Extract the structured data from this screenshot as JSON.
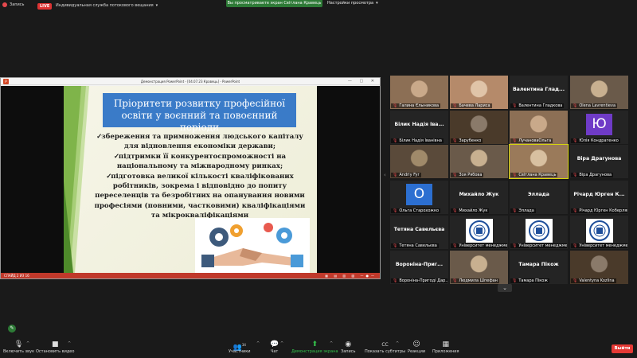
{
  "topbar": {
    "recording_label": "Запись",
    "live_badge": "LIVE",
    "live_service": "Индивидуальная служба потокового вещания",
    "viewing_banner": "Вы просматриваете экран Світлана Кравець",
    "view_options": "Настройки просмотра"
  },
  "ppt": {
    "window_title": "Демонстрация PowerPoint - [04.07.23 Кравець] - PowerPoint",
    "logo_letter": "P",
    "status_text": "СЛАЙД 2 ИЗ 16"
  },
  "slide": {
    "title": "Пріоритети розвитку професійної освіти у воєнний та повоєнний періоди",
    "bullets": [
      "збереження та примноження людського капіталу для відновлення економіки держави;",
      "підтримки її конкурентоспроможності на національному та міжнародному ринках;",
      "підготовка великої кількості кваліфікованих робітників, зокрема і відповідно до попиту переселенців та безробітних на опанування новими професіями (повними, частковими) кваліфікаціями та мікрокваліфікаціями"
    ]
  },
  "gallery": {
    "tiles": [
      {
        "label": "Галина Єлыникова",
        "name": "",
        "type": "video",
        "active": false
      },
      {
        "label": "Бачева Лариса",
        "name": "",
        "type": "video",
        "active": false
      },
      {
        "label": "Валентина Гладкова",
        "name": "Валентина Глад...",
        "type": "name",
        "active": false
      },
      {
        "label": "Olena Lavrentieva",
        "name": "",
        "type": "video",
        "active": false
      },
      {
        "label": "Білик Надія Іванівна",
        "name": "Білик Надія Іва...",
        "type": "name",
        "active": false
      },
      {
        "label": "Зарубенко",
        "name": "",
        "type": "video",
        "active": false
      },
      {
        "label": "ЛучановаОльга",
        "name": "",
        "type": "video",
        "active": false
      },
      {
        "label": "Юлія Кондратенко",
        "name": "",
        "type": "avatar-yu",
        "active": false
      },
      {
        "label": "Andriy Fyr",
        "name": "",
        "type": "video",
        "active": false
      },
      {
        "label": "Зоя Рябова",
        "name": "",
        "type": "video",
        "active": false
      },
      {
        "label": "Світлана Кравець",
        "name": "",
        "type": "video",
        "active": true
      },
      {
        "label": "Віра Драгунова",
        "name": "Віра Драгунова",
        "type": "name",
        "active": false
      },
      {
        "label": "Ольга Старохожко",
        "name": "",
        "type": "avatar-o",
        "active": false
      },
      {
        "label": "Михайло Жук",
        "name": "Михайло Жук",
        "type": "name",
        "active": false
      },
      {
        "label": "Эллада",
        "name": "Эллада",
        "type": "name",
        "active": false
      },
      {
        "label": "Річард Юрген Коберляк",
        "name": "Річард Юрген К...",
        "type": "name",
        "active": false
      },
      {
        "label": "Тетяна Савельєва",
        "name": "Тетяна Савельєва",
        "type": "name",
        "active": false
      },
      {
        "label": "Університет менеджмент",
        "name": "",
        "type": "logo",
        "active": false
      },
      {
        "label": "Університет менеджмент",
        "name": "",
        "type": "logo",
        "active": false
      },
      {
        "label": "Університет менеджмент",
        "name": "",
        "type": "logo",
        "active": false
      },
      {
        "label": "Вороніна-Пригоді Дар...",
        "name": "Вороніна-Приг...",
        "type": "name",
        "active": false
      },
      {
        "label": "Людмила Шпефан",
        "name": "",
        "type": "video",
        "active": false
      },
      {
        "label": "Тамара Пікож",
        "name": "Тамара Пікож",
        "type": "name",
        "active": false
      },
      {
        "label": "Valentyna Kozlina",
        "name": "",
        "type": "video",
        "active": false
      }
    ],
    "avatar_o": "О",
    "avatar_yu": "Ю"
  },
  "toolbar": {
    "mute": "Включить звук",
    "video": "Остановить видео",
    "participants": "Участники",
    "participants_count": "34",
    "chat": "Чат",
    "share": "Демонстрация экрана",
    "record": "Запись",
    "subtitles": "Показать субтитры",
    "reactions": "Реакции",
    "apps": "Приложения",
    "leave": "Выйти",
    "cc_badge": "CC"
  },
  "colors": {
    "share_green": "#35c44c",
    "leave_red": "#e53935",
    "slide_title_blue": "#3a7bc8",
    "active_speaker": "#d6d60c"
  }
}
